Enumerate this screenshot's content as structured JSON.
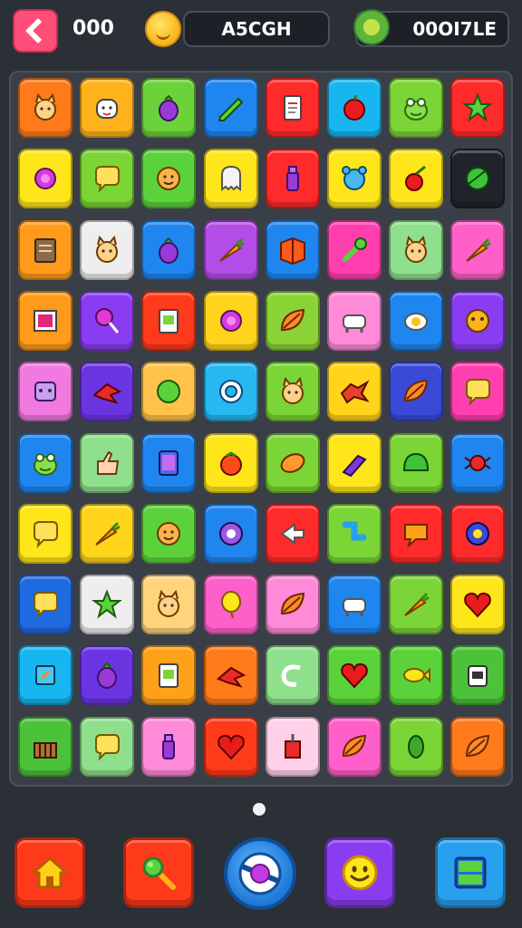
{
  "header": {
    "score_left": "000",
    "center_label": "A5CGH",
    "right_value": "00OI7LE"
  },
  "board": {
    "rows": 10,
    "cols": 8,
    "tiles": [
      [
        {
          "color": "#ff7a1a",
          "icon": "cat-face-icon"
        },
        {
          "color": "#ffb21c",
          "icon": "dog-face-icon"
        },
        {
          "color": "#6cd23a",
          "icon": "eggplant-icon"
        },
        {
          "color": "#1f86f0",
          "icon": "pencil-icon"
        },
        {
          "color": "#ff2a2a",
          "icon": "document-icon"
        },
        {
          "color": "#18b6f0",
          "icon": "apple-icon"
        },
        {
          "color": "#7bd536",
          "icon": "frog-icon"
        },
        {
          "color": "#ff2a2a",
          "icon": "star-icon"
        }
      ],
      [
        {
          "color": "#ffe61a",
          "icon": "spiky-ball-icon"
        },
        {
          "color": "#7bd536",
          "icon": "speech-bubble-icon"
        },
        {
          "color": "#5bd23a",
          "icon": "face-icon"
        },
        {
          "color": "#ffe61a",
          "icon": "ghost-icon"
        },
        {
          "color": "#ff2a2a",
          "icon": "bottle-icon"
        },
        {
          "color": "#ffe61a",
          "icon": "bear-icon"
        },
        {
          "color": "#ffe61a",
          "icon": "cherry-icon"
        },
        {
          "color": "#20242a",
          "icon": "leaf-ball-icon"
        }
      ],
      [
        {
          "color": "#ff9a1a",
          "icon": "notebook-icon"
        },
        {
          "color": "#eeeeee",
          "icon": "cat-face-icon"
        },
        {
          "color": "#1f86f0",
          "icon": "eggplant-icon"
        },
        {
          "color": "#b24de8",
          "icon": "carrot-icon"
        },
        {
          "color": "#1f86f0",
          "icon": "book-icon"
        },
        {
          "color": "#ff3fb0",
          "icon": "wrench-icon"
        },
        {
          "color": "#8fe08c",
          "icon": "cat-face-icon"
        },
        {
          "color": "#ff5fc8",
          "icon": "carrot-icon"
        }
      ],
      [
        {
          "color": "#ff9a1a",
          "icon": "picture-icon"
        },
        {
          "color": "#8a3df0",
          "icon": "lollipop-icon"
        },
        {
          "color": "#ff3a1a",
          "icon": "clipboard-icon"
        },
        {
          "color": "#ffd41a",
          "icon": "spiky-ball-icon"
        },
        {
          "color": "#8ad236",
          "icon": "leaf-icon"
        },
        {
          "color": "#ff8ad8",
          "icon": "cow-icon"
        },
        {
          "color": "#1f86f0",
          "icon": "egg-icon"
        },
        {
          "color": "#8a3df0",
          "icon": "mask-icon"
        }
      ],
      [
        {
          "color": "#f07ae0",
          "icon": "robot-face-icon"
        },
        {
          "color": "#6a35e0",
          "icon": "bird-icon"
        },
        {
          "color": "#ffc24a",
          "icon": "circle-icon"
        },
        {
          "color": "#28b8f0",
          "icon": "eye-icon"
        },
        {
          "color": "#7bd536",
          "icon": "cat-face-icon"
        },
        {
          "color": "#ffd41a",
          "icon": "dragon-icon"
        },
        {
          "color": "#3a4ad6",
          "icon": "leaf-icon"
        },
        {
          "color": "#ff3fb0",
          "icon": "speech-bubble-icon"
        }
      ],
      [
        {
          "color": "#1f86f0",
          "icon": "frog-icon"
        },
        {
          "color": "#8fe08c",
          "icon": "thumbs-up-icon"
        },
        {
          "color": "#1f86f0",
          "icon": "tablet-icon"
        },
        {
          "color": "#ffe61a",
          "icon": "tomato-icon"
        },
        {
          "color": "#7bd536",
          "icon": "bread-icon"
        },
        {
          "color": "#ffe61a",
          "icon": "crayon-icon"
        },
        {
          "color": "#7bd536",
          "icon": "turtle-shell-icon"
        },
        {
          "color": "#1f86f0",
          "icon": "spider-icon"
        }
      ],
      [
        {
          "color": "#ffe61a",
          "icon": "speech-bubble-icon"
        },
        {
          "color": "#ffd41a",
          "icon": "carrot-icon"
        },
        {
          "color": "#5bd23a",
          "icon": "face-icon"
        },
        {
          "color": "#1f86f0",
          "icon": "gear-icon"
        },
        {
          "color": "#ff2a2a",
          "icon": "arrow-icon"
        },
        {
          "color": "#7bd536",
          "icon": "pipe-icon"
        },
        {
          "color": "#ff2a2a",
          "icon": "note-icon"
        },
        {
          "color": "#ff2a2a",
          "icon": "flower-icon"
        }
      ],
      [
        {
          "color": "#1f6ae0",
          "icon": "speech-bubble-icon"
        },
        {
          "color": "#eeeeee",
          "icon": "star-icon"
        },
        {
          "color": "#ffd47a",
          "icon": "cat-face-icon"
        },
        {
          "color": "#ff5fc8",
          "icon": "balloon-icon"
        },
        {
          "color": "#ff8ad8",
          "icon": "leaf-icon"
        },
        {
          "color": "#1f86f0",
          "icon": "cow-icon"
        },
        {
          "color": "#7bd536",
          "icon": "carrot-icon"
        },
        {
          "color": "#ffe61a",
          "icon": "heart-icon"
        }
      ],
      [
        {
          "color": "#18b6f0",
          "icon": "tag-icon"
        },
        {
          "color": "#6a35e0",
          "icon": "eggplant-icon"
        },
        {
          "color": "#ffa21a",
          "icon": "clipboard-icon"
        },
        {
          "color": "#ff7a1a",
          "icon": "bird-icon"
        },
        {
          "color": "#8fe08c",
          "icon": "swirl-icon"
        },
        {
          "color": "#5bd23a",
          "icon": "heart-icon"
        },
        {
          "color": "#5bd23a",
          "icon": "fish-icon"
        },
        {
          "color": "#4cc23a",
          "icon": "robot-icon"
        }
      ],
      [
        {
          "color": "#4cc23a",
          "icon": "basket-icon"
        },
        {
          "color": "#8fe08c",
          "icon": "speech-bubble-icon"
        },
        {
          "color": "#ff8ad8",
          "icon": "bottle-icon"
        },
        {
          "color": "#ff3a1a",
          "icon": "heart-icon"
        },
        {
          "color": "#ffd1e8",
          "icon": "pin-icon"
        },
        {
          "color": "#ff5fc8",
          "icon": "leaf-icon"
        },
        {
          "color": "#7bd536",
          "icon": "bean-icon"
        },
        {
          "color": "#ff7a1a",
          "icon": "leaf-icon"
        }
      ]
    ]
  },
  "pagination": {
    "current": 1,
    "total": 1
  },
  "bottom_nav": [
    {
      "name": "home-button",
      "icon": "home-icon",
      "color": "#ff3a1a"
    },
    {
      "name": "hammer-button",
      "icon": "hammer-icon",
      "color": "#ff3a1a"
    },
    {
      "name": "play-button",
      "icon": "ball-icon",
      "color": "#1e78d6"
    },
    {
      "name": "smiley-button",
      "icon": "smiley-icon",
      "color": "#8a3df0"
    },
    {
      "name": "layout-button",
      "icon": "panel-icon",
      "color": "#1f86f0"
    }
  ]
}
